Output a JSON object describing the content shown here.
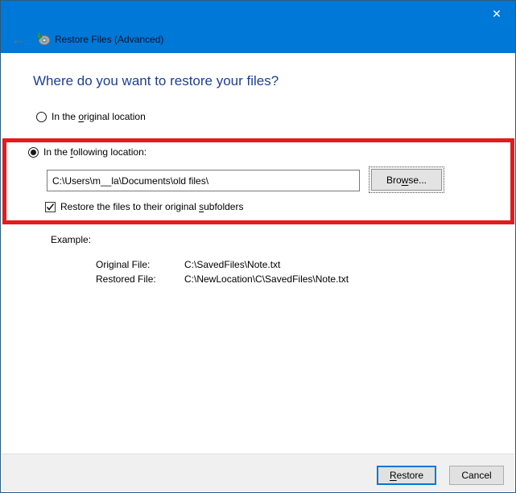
{
  "window": {
    "title": "Restore Files (Advanced)",
    "back_icon_glyph": "←",
    "close_icon_glyph": "✕"
  },
  "content": {
    "heading": "Where do you want to restore your files?",
    "radio_original": {
      "pre": "In the ",
      "accel": "o",
      "post": "riginal location",
      "selected": false
    },
    "radio_following": {
      "pre": "In the ",
      "accel": "f",
      "post": "ollowing location:",
      "selected": true
    },
    "location_input": {
      "value": "C:\\Users\\m__la\\Documents\\old files\\"
    },
    "browse_button": {
      "pre": "Bro",
      "accel": "w",
      "post": "se..."
    },
    "checkbox_subfolders": {
      "pre": "Restore the files to their original ",
      "accel": "s",
      "post": "ubfolders",
      "checked": true
    },
    "example": {
      "label": "Example:",
      "rows": [
        {
          "name": "Original File:",
          "value": "C:\\SavedFiles\\Note.txt"
        },
        {
          "name": "Restored File:",
          "value": "C:\\NewLocation\\C\\SavedFiles\\Note.txt"
        }
      ]
    }
  },
  "footer": {
    "restore_button": {
      "accel": "R",
      "post": "estore"
    },
    "cancel_button": "Cancel"
  },
  "annotation": {
    "type": "red-rectangle-highlight",
    "color": "#e31b1c"
  },
  "colors": {
    "titlebar_blue": "#0078d7",
    "heading_blue": "#1d3f94",
    "footer_gray": "#f0f0f0",
    "window_border": "#2a5a7c"
  }
}
